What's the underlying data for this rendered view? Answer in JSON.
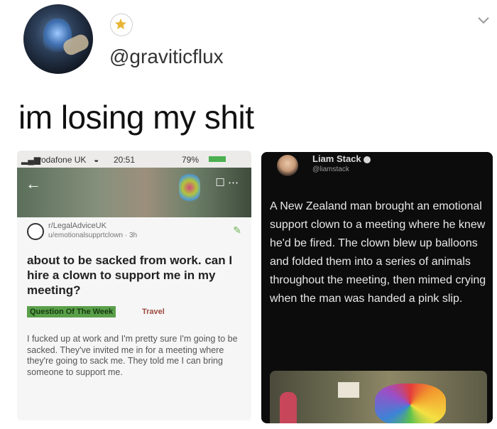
{
  "tweet": {
    "handle": "@graviticflux",
    "text": "im losing my shit"
  },
  "reddit": {
    "status": {
      "carrier": "vodafone UK",
      "time": "20:51",
      "battery": "79%"
    },
    "subreddit": "r/LegalAdviceUK",
    "user": "u/emotionalsupprtclown · 3h",
    "title": "about to be sacked from work. can I hire a clown to support me in my meeting?",
    "flair": "Question Of The Week",
    "flair_tag": "Travel",
    "body": "I fucked up at work and I'm pretty sure I'm going to be sacked. They've invited me in for a meeting where they're going to sack me. They told me I can bring someone to support me."
  },
  "embedded_tweet": {
    "name": "Liam Stack",
    "handle": "@liamstack",
    "text": "A New Zealand man brought an emotional support clown to a meeting where he knew he'd be fired. The clown blew up balloons and folded them into a series of animals throughout the meeting, then mimed crying when the man was handed a pink slip."
  },
  "colors": {
    "flair_bg": "#5aa04a",
    "dark_card": "#0c0c0c"
  }
}
